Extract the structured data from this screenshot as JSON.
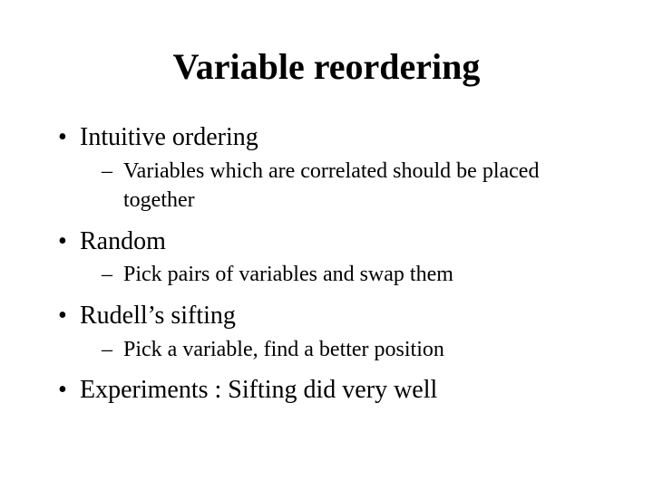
{
  "title": "Variable reordering",
  "bullets": [
    {
      "label": "Intuitive ordering",
      "sub": [
        "Variables which are correlated should be placed together"
      ]
    },
    {
      "label": "Random",
      "sub": [
        "Pick pairs of variables and swap them"
      ]
    },
    {
      "label": "Rudell’s sifting",
      "sub": [
        "Pick a variable, find a better position"
      ]
    },
    {
      "label": "Experiments : Sifting did very well",
      "sub": []
    }
  ]
}
